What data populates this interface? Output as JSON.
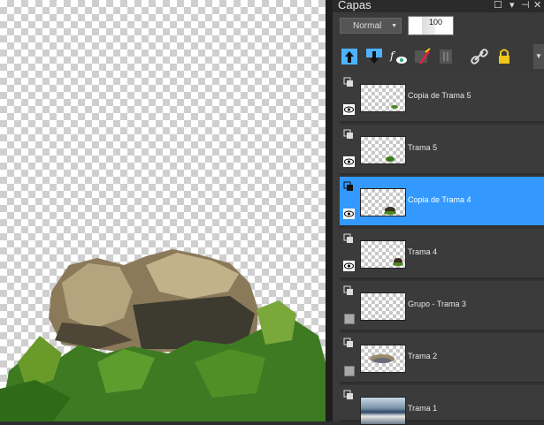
{
  "panel": {
    "title": "Capas",
    "blend_mode": "Normal",
    "opacity": "100"
  },
  "toolbar": {
    "icons": [
      "new-raster-layer-icon",
      "new-layer-below-icon",
      "fx-effects-icon",
      "mask-brush-icon",
      "delete-layer-icon",
      "link-icon",
      "lock-icon"
    ]
  },
  "layers": [
    {
      "name": "Copia de Trama 5",
      "visible": true,
      "selected": false
    },
    {
      "name": "Trama 5",
      "visible": true,
      "selected": false
    },
    {
      "name": "Copia de Trama 4",
      "visible": true,
      "selected": true
    },
    {
      "name": "Trama 4",
      "visible": true,
      "selected": false
    },
    {
      "name": "Grupo - Trama 3",
      "visible": false,
      "selected": false
    },
    {
      "name": "Trama 2",
      "visible": false,
      "selected": false
    },
    {
      "name": "Trama 1",
      "visible": false,
      "selected": false
    }
  ]
}
